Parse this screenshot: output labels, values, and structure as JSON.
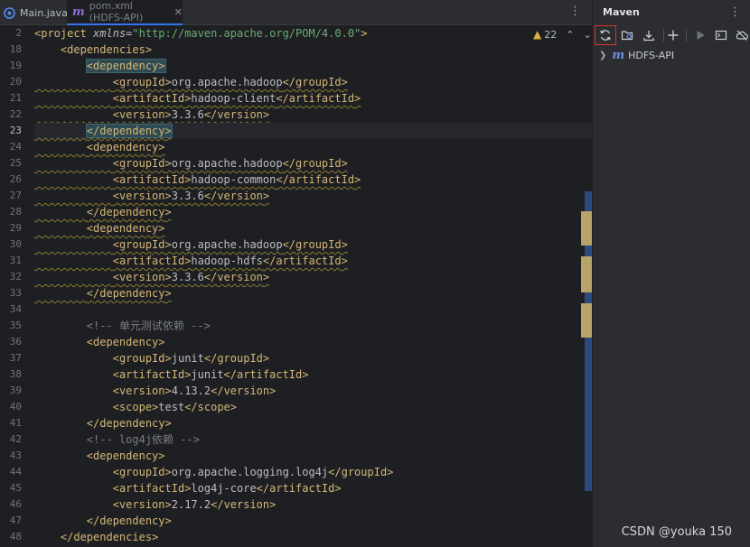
{
  "tabs": [
    {
      "label": "Main.java",
      "icon": "java-class-icon"
    },
    {
      "label": "pom.xml (HDFS-API)",
      "icon": "maven-m-icon",
      "active": true
    }
  ],
  "editor": {
    "warnings_count": "22",
    "current_line": 23,
    "line_numbers": [
      "2",
      "18",
      "19",
      "20",
      "21",
      "22",
      "23",
      "24",
      "25",
      "26",
      "27",
      "28",
      "29",
      "30",
      "31",
      "32",
      "33",
      "34",
      "35",
      "36",
      "37",
      "38",
      "39",
      "40",
      "41",
      "42",
      "43",
      "44",
      "45",
      "46",
      "47",
      "48"
    ],
    "project_xmlns": "\"http://maven.apache.org/POM/4.0.0\"",
    "deps": [
      {
        "groupId": "org.apache.hadoop",
        "artifactId": "hadoop-client",
        "version": "3.3.6"
      },
      {
        "groupId": "org.apache.hadoop",
        "artifactId": "hadoop-common",
        "version": "3.3.6"
      },
      {
        "groupId": "org.apache.hadoop",
        "artifactId": "hadoop-hdfs",
        "version": "3.3.6"
      },
      {
        "groupId": "junit",
        "artifactId": "junit",
        "version": "4.13.2",
        "scope": "test"
      },
      {
        "groupId": "org.apache.logging.log4j",
        "artifactId": "log4j-core",
        "version": "2.17.2"
      }
    ],
    "comment_junit": "<!-- 单元测试依赖 -->",
    "comment_log4j": "<!-- log4j依赖 -->"
  },
  "maven": {
    "title": "Maven",
    "project": "HDFS-API"
  },
  "watermark": "CSDN @youka 150",
  "colors": {
    "accent": "#3574f0",
    "highlight_border": "#d9342b"
  }
}
